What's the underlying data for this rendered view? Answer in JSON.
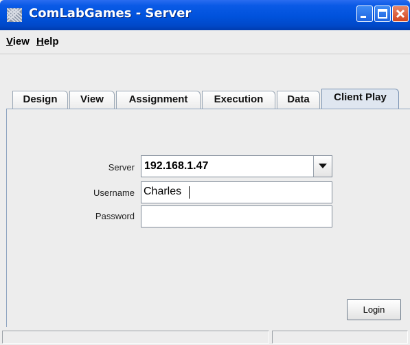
{
  "window": {
    "title": "ComLabGames - Server",
    "colors": {
      "titlebar": "#0052dc",
      "close_button": "#d3461f",
      "background": "#ededed"
    }
  },
  "icons": {
    "app": "comlabgames-logo-icon",
    "minimize": "minimize-icon",
    "maximize": "maximize-icon",
    "close": "close-icon",
    "dropdown": "chevron-down-icon"
  },
  "menubar": {
    "items": [
      {
        "label": "View"
      },
      {
        "label": "Help"
      }
    ]
  },
  "tabs": [
    {
      "label": "Design",
      "selected": false
    },
    {
      "label": "View",
      "selected": false
    },
    {
      "label": "Assignment",
      "selected": false
    },
    {
      "label": "Execution",
      "selected": false
    },
    {
      "label": "Data",
      "selected": false
    },
    {
      "label": "Client Play",
      "selected": true
    }
  ],
  "form": {
    "server": {
      "label": "Server",
      "value": "192.168.1.47"
    },
    "username": {
      "label": "Username",
      "value": "Charles"
    },
    "password": {
      "label": "Password",
      "value": ""
    },
    "login_label": "Login"
  }
}
